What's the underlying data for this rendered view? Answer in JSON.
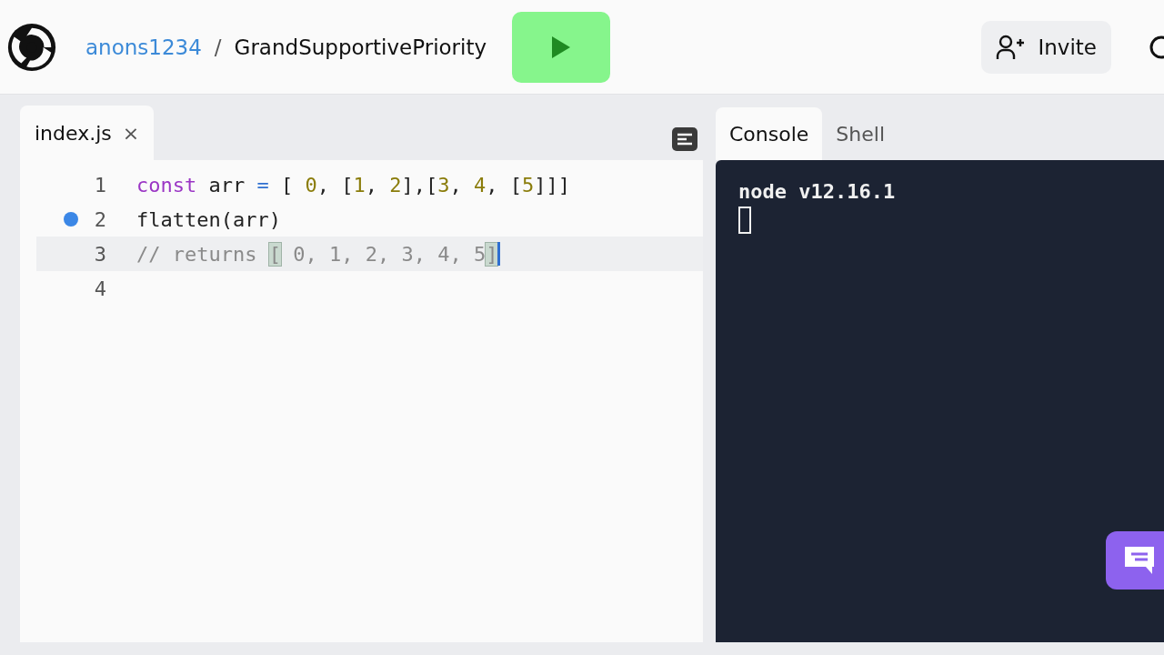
{
  "header": {
    "owner": "anons1234",
    "separator": "/",
    "repl_name": "GrandSupportivePriority",
    "invite": "Invite"
  },
  "editor": {
    "tabs": [
      {
        "label": "index.js",
        "selected": true,
        "close": "×"
      }
    ],
    "lines": [
      {
        "number": "1",
        "breakpoint": false,
        "active": false,
        "tokens": [
          {
            "text": "const",
            "kind": "keyword"
          },
          {
            "text": " arr ",
            "kind": "plain"
          },
          {
            "text": "=",
            "kind": "operator"
          },
          {
            "text": " [ ",
            "kind": "plain"
          },
          {
            "text": "0",
            "kind": "number"
          },
          {
            "text": ", [",
            "kind": "plain"
          },
          {
            "text": "1",
            "kind": "number"
          },
          {
            "text": ", ",
            "kind": "plain"
          },
          {
            "text": "2",
            "kind": "number"
          },
          {
            "text": "],[",
            "kind": "plain"
          },
          {
            "text": "3",
            "kind": "number"
          },
          {
            "text": ", ",
            "kind": "plain"
          },
          {
            "text": "4",
            "kind": "number"
          },
          {
            "text": ", [",
            "kind": "plain"
          },
          {
            "text": "5",
            "kind": "number"
          },
          {
            "text": "]]]",
            "kind": "plain"
          }
        ]
      },
      {
        "number": "2",
        "breakpoint": true,
        "active": false,
        "tokens": [
          {
            "text": "flatten(arr)",
            "kind": "plain"
          }
        ]
      },
      {
        "number": "3",
        "breakpoint": false,
        "active": true,
        "tokens": [
          {
            "text": "// returns ",
            "kind": "comment"
          },
          {
            "text": "[",
            "kind": "match"
          },
          {
            "text": " 0, 1, 2, 3, 4, 5",
            "kind": "comment"
          },
          {
            "text": "]",
            "kind": "match"
          }
        ]
      },
      {
        "number": "4",
        "breakpoint": false,
        "active": false
      }
    ]
  },
  "console": {
    "tabs": [
      {
        "label": "Console",
        "selected": true
      },
      {
        "label": "Shell",
        "selected": false
      }
    ],
    "output": "node v12.16.1"
  }
}
